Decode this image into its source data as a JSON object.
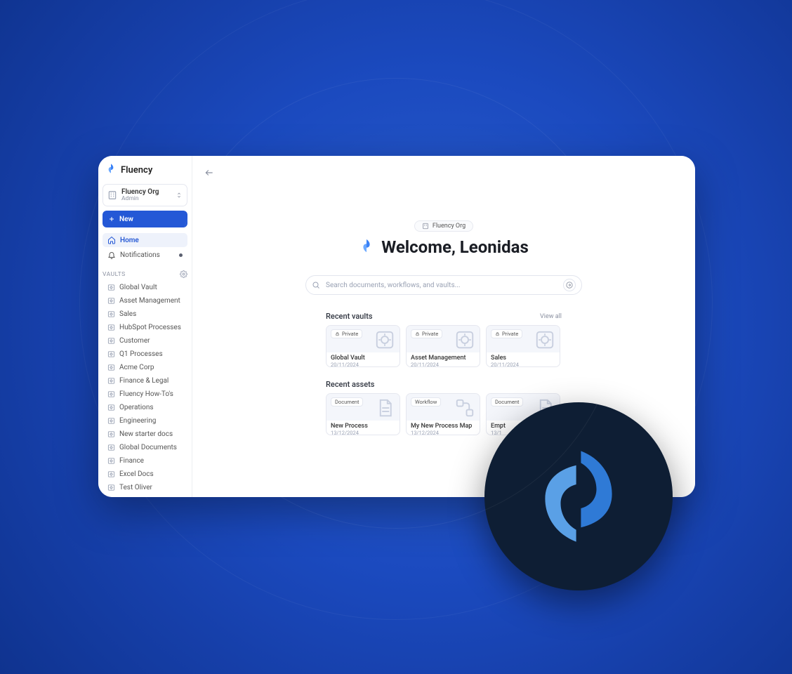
{
  "brand": {
    "name": "Fluency"
  },
  "org": {
    "name": "Fluency Org",
    "role": "Admin"
  },
  "sidebar": {
    "new_label": "New",
    "home_label": "Home",
    "notifications_label": "Notifications",
    "vaults_heading": "VAULTS",
    "vaults": [
      "Global Vault",
      "Asset Management",
      "Sales",
      "HubSpot Processes",
      "Customer",
      "Q1 Processes",
      "Acme Corp",
      "Finance & Legal",
      "Fluency How-To's",
      "Operations",
      "Engineering",
      "New starter docs",
      "Global Documents",
      "Finance",
      "Excel Docs",
      "Test Oliver"
    ]
  },
  "main": {
    "org_chip": "Fluency Org",
    "welcome": "Welcome, Leonidas",
    "search_placeholder": "Search documents, workflows, and vaults...",
    "recent_vaults_title": "Recent vaults",
    "view_all": "View all",
    "recent_vaults": [
      {
        "badge": "Private",
        "title": "Global Vault",
        "date": "20/11/2024"
      },
      {
        "badge": "Private",
        "title": "Asset Management",
        "date": "20/11/2024"
      },
      {
        "badge": "Private",
        "title": "Sales",
        "date": "20/11/2024"
      }
    ],
    "recent_assets_title": "Recent assets",
    "recent_assets": [
      {
        "badge": "Document",
        "title": "New Process",
        "date": "13/12/2024"
      },
      {
        "badge": "Workflow",
        "title": "My New Process Map",
        "date": "13/12/2024"
      },
      {
        "badge": "Document",
        "title": "Empt",
        "date": "13/1"
      }
    ]
  }
}
